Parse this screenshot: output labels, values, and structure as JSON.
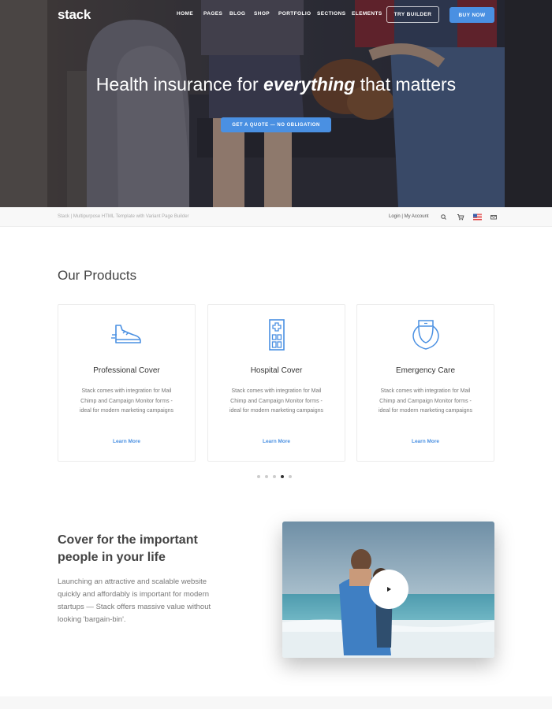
{
  "nav": {
    "logo": "stack",
    "links": [
      "HOME",
      "PAGES",
      "BLOG",
      "SHOP",
      "PORTFOLIO",
      "SECTIONS",
      "ELEMENTS"
    ],
    "try_builder": "TRY BUILDER",
    "buy_now": "BUY NOW"
  },
  "hero": {
    "title_before": "Health insurance for ",
    "title_emphasis": "everything",
    "title_after": " that matters",
    "cta": "GET A QUOTE — NO OBLIGATION"
  },
  "utility": {
    "tagline": "Stack | Multipurpose HTML Template with Variant Page Builder",
    "login": "Login | My Account",
    "icons": [
      "search-icon",
      "cart-icon",
      "us-flag-icon",
      "mail-icon"
    ]
  },
  "products": {
    "title": "Our Products",
    "cards": [
      {
        "title": "Professional Cover",
        "text": "Stack comes with integration for Mail Chimp and Campaign Monitor forms - ideal for modern marketing campaigns",
        "link": "Learn More",
        "icon": "shoe-icon"
      },
      {
        "title": "Hospital Cover",
        "text": "Stack comes with integration for Mail Chimp and Campaign Monitor forms - ideal for modern marketing campaigns",
        "link": "Learn More",
        "icon": "hospital-icon"
      },
      {
        "title": "Emergency Care",
        "text": "Stack comes with integration for Mail Chimp and Campaign Monitor forms - ideal for modern marketing campaigns",
        "link": "Learn More",
        "icon": "nurse-icon"
      }
    ],
    "active_slide": 4,
    "slide_count": 5
  },
  "feature": {
    "title": "Cover for the important people in your life",
    "text": "Launching an attractive and scalable website quickly and affordably is important for modern startups — Stack offers massive value without looking 'bargain-bin'."
  },
  "colors": {
    "accent": "#4a90e2",
    "heading": "#444444",
    "body": "#777777"
  }
}
